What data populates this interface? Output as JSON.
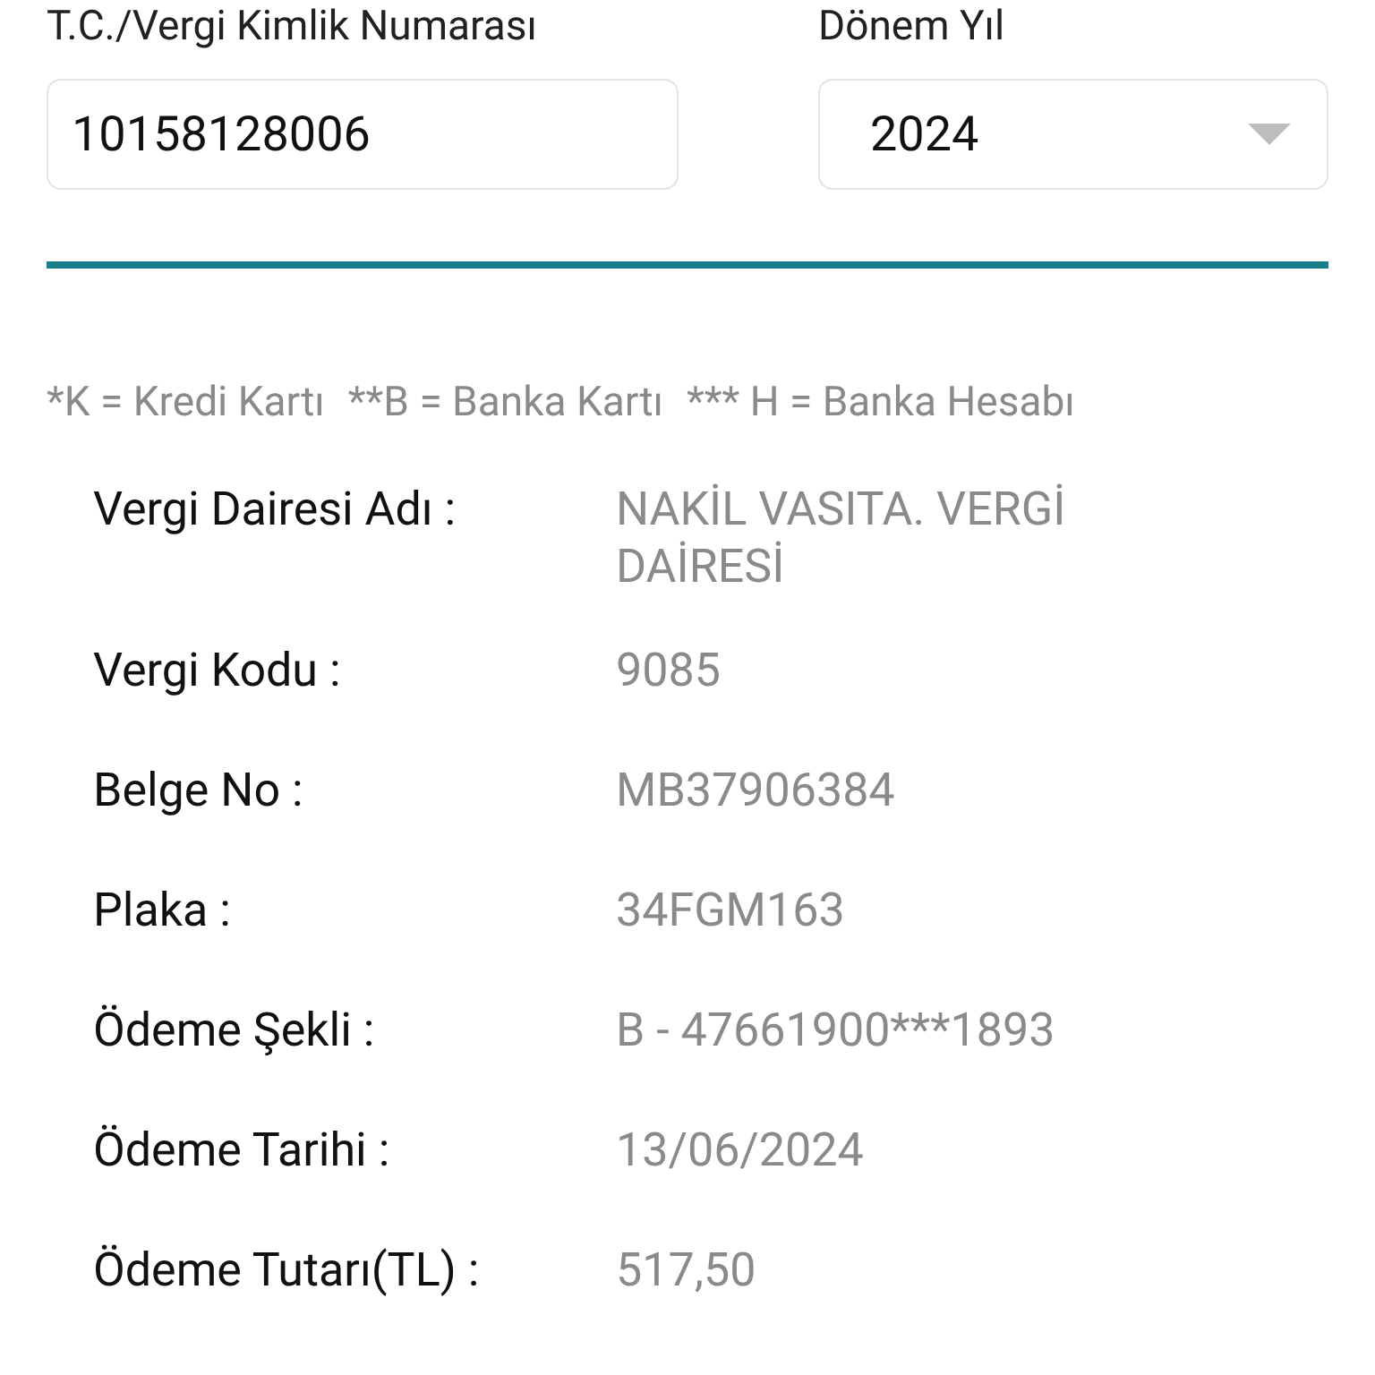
{
  "taxpayer_id": {
    "label": "T.C./Vergi Kimlik Numarası",
    "value": "10158128006"
  },
  "period_year": {
    "label": "Dönem Yıl",
    "value": "2024"
  },
  "legend": [
    "*K = Kredi Kartı",
    "**B = Banka Kartı",
    "*** H = Banka Hesabı"
  ],
  "details": [
    {
      "label": "Vergi Dairesi Adı :",
      "value": "NAKİL VASITA. VERGİ DAİRESİ"
    },
    {
      "label": "Vergi Kodu :",
      "value": "9085"
    },
    {
      "label": "Belge No :",
      "value": "MB37906384"
    },
    {
      "label": "Plaka :",
      "value": "34FGM163"
    },
    {
      "label": "Ödeme Şekli :",
      "value": "B - 47661900***1893"
    },
    {
      "label": "Ödeme Tarihi :",
      "value": "13/06/2024"
    },
    {
      "label": "Ödeme Tutarı(TL) :",
      "value": "517,50"
    }
  ]
}
